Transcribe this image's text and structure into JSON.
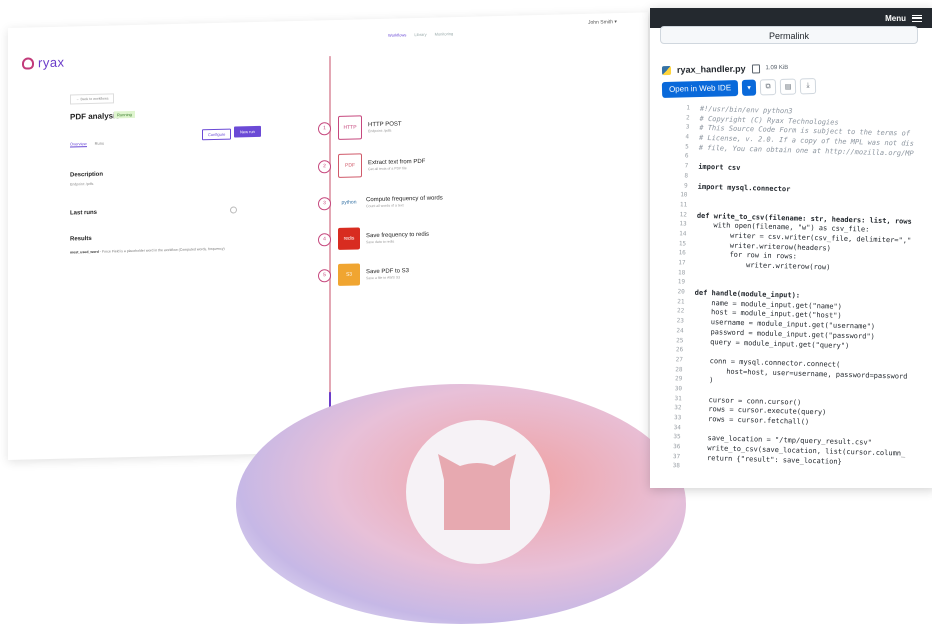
{
  "app": {
    "logo": "ryax",
    "nav": [
      "Workflows",
      "Library",
      "Monitoring"
    ],
    "user": "John Smith",
    "back_label": "← Back to workflows",
    "title": "PDF analysis",
    "badge": "Running",
    "tabs": [
      "Overview",
      "Runs"
    ],
    "btn_outline": "Configure",
    "btn_primary": "New run",
    "description_title": "Description",
    "description_text": "Endpoint: /pdfs",
    "lastruns_title": "Last runs",
    "results_title": "Results",
    "results_key": "most_used_word",
    "results_text": "- Force Field is a placeholder word in the workflow (Computed words, frequency)",
    "steps": [
      {
        "num": "1",
        "icon": "HTTP",
        "title": "HTTP POST",
        "sub": "Endpoint: /pdfs"
      },
      {
        "num": "2",
        "icon": "PDF",
        "title": "Extract text from PDF",
        "sub": "Get all texts of a PDF file"
      },
      {
        "num": "3",
        "icon": "python",
        "title": "Compute frequency of words",
        "sub": "Count all words of a text"
      },
      {
        "num": "4",
        "icon": "redis",
        "title": "Save frequency to redis",
        "sub": "Save data to redis"
      },
      {
        "num": "5",
        "icon": "S3",
        "title": "Save PDF to S3",
        "sub": "Save a file to AWS S3"
      }
    ]
  },
  "code_panel": {
    "menu": "Menu",
    "permalink": "Permalink",
    "file_name": "ryax_handler.py",
    "file_size": "1.09 KiB",
    "open_ide": "Open in Web IDE",
    "lines": [
      {
        "n": "1",
        "t": "#!/usr/bin/env python3",
        "k": "c"
      },
      {
        "n": "2",
        "t": "# Copyright (C) Ryax Technologies",
        "k": "c"
      },
      {
        "n": "3",
        "t": "# This Source Code Form is subject to the terms of",
        "k": "c"
      },
      {
        "n": "4",
        "t": "# License, v. 2.0. If a copy of the MPL was not dis",
        "k": "c"
      },
      {
        "n": "5",
        "t": "# file, You can obtain one at http://mozilla.org/MP",
        "k": "c"
      },
      {
        "n": "6",
        "t": "",
        "k": "n"
      },
      {
        "n": "7",
        "t": "import csv",
        "k": "i"
      },
      {
        "n": "8",
        "t": "",
        "k": "n"
      },
      {
        "n": "9",
        "t": "import mysql.connector",
        "k": "i"
      },
      {
        "n": "10",
        "t": "",
        "k": "n"
      },
      {
        "n": "11",
        "t": "",
        "k": "n"
      },
      {
        "n": "12",
        "t": "def write_to_csv(filename: str, headers: list, rows",
        "k": "d"
      },
      {
        "n": "13",
        "t": "    with open(filename, \"w\") as csv_file:",
        "k": "n"
      },
      {
        "n": "14",
        "t": "        writer = csv.writer(csv_file, delimiter=\",\"",
        "k": "n"
      },
      {
        "n": "15",
        "t": "        writer.writerow(headers)",
        "k": "n"
      },
      {
        "n": "16",
        "t": "        for row in rows:",
        "k": "n"
      },
      {
        "n": "17",
        "t": "            writer.writerow(row)",
        "k": "n"
      },
      {
        "n": "18",
        "t": "",
        "k": "n"
      },
      {
        "n": "19",
        "t": "",
        "k": "n"
      },
      {
        "n": "20",
        "t": "def handle(module_input):",
        "k": "d"
      },
      {
        "n": "21",
        "t": "    name = module_input.get(\"name\")",
        "k": "n"
      },
      {
        "n": "22",
        "t": "    host = module_input.get(\"host\")",
        "k": "n"
      },
      {
        "n": "23",
        "t": "    username = module_input.get(\"username\")",
        "k": "n"
      },
      {
        "n": "24",
        "t": "    password = module_input.get(\"password\")",
        "k": "n"
      },
      {
        "n": "25",
        "t": "    query = module_input.get(\"query\")",
        "k": "n"
      },
      {
        "n": "26",
        "t": "",
        "k": "n"
      },
      {
        "n": "27",
        "t": "    conn = mysql.connector.connect(",
        "k": "n"
      },
      {
        "n": "28",
        "t": "        host=host, user=username, password=password",
        "k": "n"
      },
      {
        "n": "29",
        "t": "    )",
        "k": "n"
      },
      {
        "n": "30",
        "t": "",
        "k": "n"
      },
      {
        "n": "31",
        "t": "    cursor = conn.cursor()",
        "k": "n"
      },
      {
        "n": "32",
        "t": "    rows = cursor.execute(query)",
        "k": "n"
      },
      {
        "n": "33",
        "t": "    rows = cursor.fetchall()",
        "k": "n"
      },
      {
        "n": "34",
        "t": "",
        "k": "n"
      },
      {
        "n": "35",
        "t": "    save_location = \"/tmp/query_result.csv\"",
        "k": "n"
      },
      {
        "n": "36",
        "t": "    write_to_csv(save_location, list(cursor.column_",
        "k": "n"
      },
      {
        "n": "37",
        "t": "    return {\"result\": save_location}",
        "k": "n"
      },
      {
        "n": "38",
        "t": "",
        "k": "n"
      }
    ]
  },
  "colors": {
    "accent": "#6b4ad6",
    "timeline": "#e3a7b4",
    "ide_button": "#0969da"
  }
}
